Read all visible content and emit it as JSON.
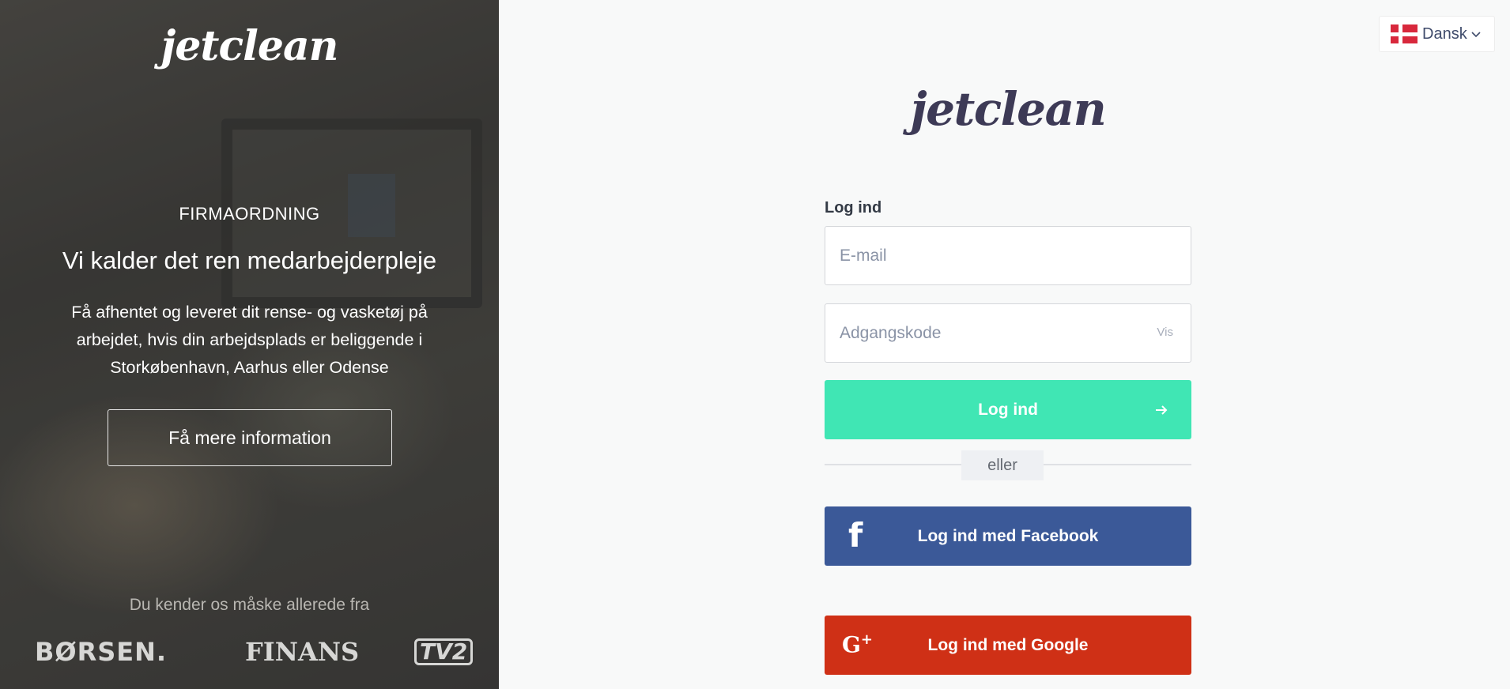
{
  "left": {
    "logo": "jetclean",
    "section_label": "FIRMAORDNING",
    "headline": "Vi kalder det ren medarbejderpleje",
    "description": "Få afhentet og leveret dit rense- og vasketøj på arbejdet, hvis din arbejdsplads er beliggende i Storkøbenhavn, Aarhus eller Odense",
    "info_button": "Få mere information",
    "known_from": "Du kender os måske allerede fra",
    "press": [
      "BØRSEN.",
      "FINANS",
      "TV2"
    ]
  },
  "language": {
    "label": "Dansk",
    "flag": "denmark-flag-icon"
  },
  "form": {
    "logo": "jetclean",
    "title": "Log ind",
    "email_placeholder": "E-mail",
    "password_placeholder": "Adgangskode",
    "show_password": "Vis",
    "login_button": "Log ind",
    "or_label": "eller",
    "facebook_button": "Log ind med Facebook",
    "google_button": "Log ind med Google"
  },
  "colors": {
    "accent": "#40e6b4",
    "facebook": "#3b5998",
    "google": "#cf3016",
    "logo": "#3d3a56"
  }
}
